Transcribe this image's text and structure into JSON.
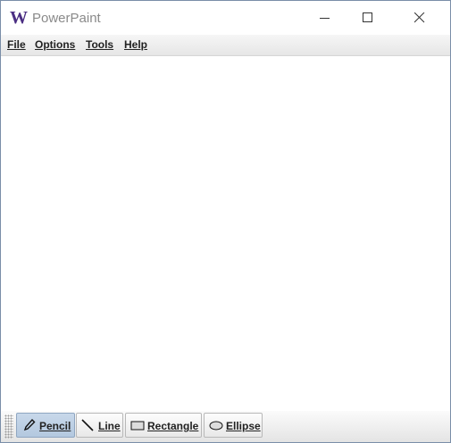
{
  "window": {
    "logo": "W",
    "title": "PowerPaint",
    "icons": {
      "minimize": "minimize-icon",
      "maximize": "maximize-icon",
      "close": "close-icon"
    }
  },
  "menu": {
    "items": [
      {
        "label": "File"
      },
      {
        "label": "Options"
      },
      {
        "label": "Tools"
      },
      {
        "label": "Help"
      }
    ]
  },
  "toolbar": {
    "tools": [
      {
        "label": "Pencil",
        "icon": "pencil-icon",
        "selected": true
      },
      {
        "label": "Line",
        "icon": "line-icon",
        "selected": false
      },
      {
        "label": "Rectangle",
        "icon": "rectangle-icon",
        "selected": false
      },
      {
        "label": "Ellipse",
        "icon": "ellipse-icon",
        "selected": false
      }
    ]
  },
  "colors": {
    "logo": "#4b2e83",
    "selected_tool": "#b8cbe0"
  }
}
